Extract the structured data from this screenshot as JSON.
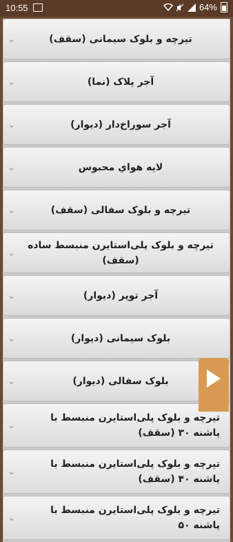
{
  "status_bar": {
    "time": "10:55",
    "battery": "64%"
  },
  "items": [
    {
      "label": "تیرچه و بلوک سیمانی (سقف)"
    },
    {
      "label": "آجر پلاک (نما)"
    },
    {
      "label": "آجر سوراخ‌دار (دیوار)"
    },
    {
      "label": "لایه هواي محبوس"
    },
    {
      "label": "تیرچه و بلوک سفالی (سقف)"
    },
    {
      "label": "تیرچه و بلوک پلی‌استایرن منبسط ساده (سقف)"
    },
    {
      "label": "آجر توپر (دیوار)"
    },
    {
      "label": "بلوک سیمانی (دیوار)"
    },
    {
      "label": "بلوک سفالی (دیوار)"
    },
    {
      "label": "تیرچه و بلوک پلی‌استایرن منبسط با پاشنه ۳۰ (سقف)"
    },
    {
      "label": "تیرچه و بلوک پلی‌استایرن منبسط با پاشنه ۴۰ (سقف)"
    },
    {
      "label": "تیرچه و بلوک پلی‌استایرن منبسط با پاشنه ۵۰"
    }
  ],
  "colors": {
    "status_bar": "#5a3b27",
    "background": "#6b4a33",
    "fab": "#d89a52"
  }
}
